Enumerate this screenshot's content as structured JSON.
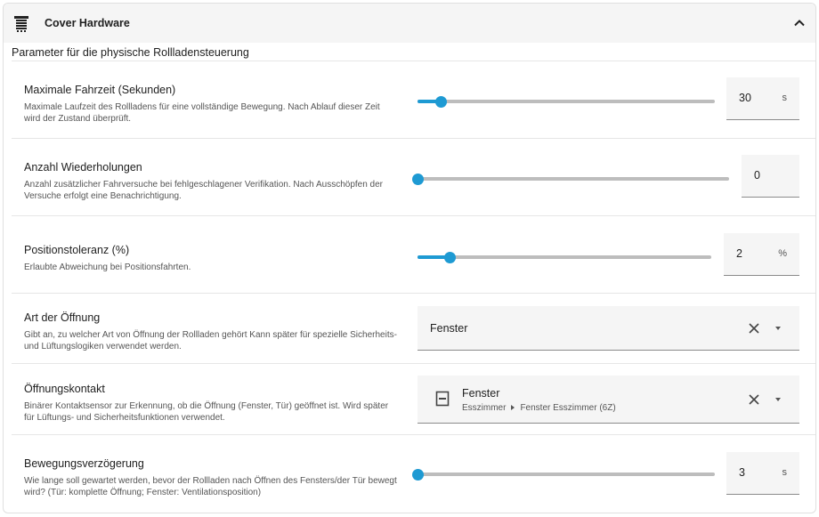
{
  "header": {
    "title": "Cover Hardware",
    "icon": "window-shutter-icon",
    "collapse_icon": "chevron-up-icon"
  },
  "section_title": "Parameter für die physische Rollladensteuerung",
  "accent_color": "#1e9ad3",
  "rows": {
    "max_time": {
      "label": "Maximale Fahrzeit (Sekunden)",
      "desc": "Maximale Laufzeit des Rollladens für eine vollständige Bewegung. Nach Ablauf dieser Zeit wird der Zustand überprüft.",
      "value": "30",
      "unit": "s",
      "slider_fraction": 0.08
    },
    "retries": {
      "label": "Anzahl Wiederholungen",
      "desc": "Anzahl zusätzlicher Fahrversuche bei fehlgeschlagener Verifikation. Nach Ausschöpfen der Versuche erfolgt eine Benachrichtigung.",
      "value": "0",
      "slider_fraction": 0.0
    },
    "tolerance": {
      "label": "Positionstoleranz (%)",
      "desc": "Erlaubte Abweichung bei Positionsfahrten.",
      "value": "2",
      "unit": "%",
      "slider_fraction": 0.11
    },
    "opening_type": {
      "label": "Art der Öffnung",
      "desc": "Gibt an, zu welcher Art von Öffnung der Rollladen gehört Kann später für spezielle Sicherheits- und Lüftungslogiken verwendet werden.",
      "value": "Fenster"
    },
    "contact": {
      "label": "Öffnungskontakt",
      "desc": "Binärer Kontaktsensor zur Erkennung, ob die Öffnung (Fenster, Tür) geöffnet ist. Wird später für Lüftungs- und Sicherheitsfunktionen verwendet.",
      "value": "Fenster",
      "area": "Esszimmer",
      "entity": "Fenster Esszimmer (6Z)",
      "icon": "window-sensor-icon"
    },
    "delay": {
      "label": "Bewegungsverzögerung",
      "desc": "Wie lange soll gewartet werden, bevor der Rollladen nach Öffnen des Fensters/der Tür bewegt wird? (Tür: komplette Öffnung; Fenster: Ventilationsposition)",
      "value": "3",
      "unit": "s",
      "slider_fraction": 0.0
    }
  }
}
